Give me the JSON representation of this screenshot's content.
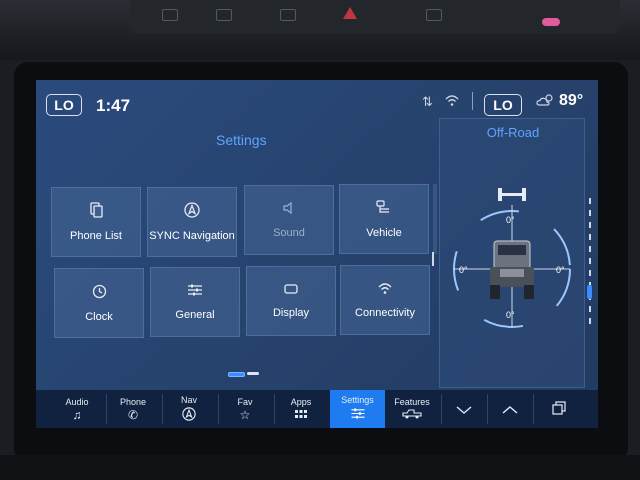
{
  "status_bar": {
    "left_temp": "LO",
    "time": "1:47",
    "right_temp": "LO",
    "outside_temp": "89°",
    "icons": [
      "data-arrows-icon",
      "wifi-icon",
      "weather-cloud-sun-icon"
    ]
  },
  "settings": {
    "title": "Settings",
    "tiles": [
      {
        "label": "Phone List",
        "icon": "phone-list-icon",
        "enabled": true
      },
      {
        "label": "SYNC Navigation",
        "icon": "navigation-icon",
        "enabled": true
      },
      {
        "label": "Sound",
        "icon": "speaker-icon",
        "enabled": false
      },
      {
        "label": "Vehicle",
        "icon": "vehicle-settings-icon",
        "enabled": true
      },
      {
        "label": "Clock",
        "icon": "clock-icon",
        "enabled": true
      },
      {
        "label": "General",
        "icon": "sliders-icon",
        "enabled": true
      },
      {
        "label": "Display",
        "icon": "display-icon",
        "enabled": true
      },
      {
        "label": "Connectivity",
        "icon": "wifi-icon",
        "enabled": true
      }
    ],
    "page_indicator": {
      "pages": 2,
      "current": 1
    }
  },
  "offroad": {
    "title": "Off-Road",
    "pitch_top": "0°",
    "pitch_bottom": "0°",
    "roll_left": "0°",
    "roll_right": "0°"
  },
  "nav": {
    "items": [
      {
        "label": "Audio",
        "icon": "music-note-icon"
      },
      {
        "label": "Phone",
        "icon": "phone-icon"
      },
      {
        "label": "Nav",
        "icon": "navigation-icon"
      },
      {
        "label": "Fav",
        "icon": "star-icon"
      },
      {
        "label": "Apps",
        "icon": "apps-grid-icon"
      },
      {
        "label": "Settings",
        "icon": "sliders-icon",
        "active": true
      },
      {
        "label": "Features",
        "icon": "truck-icon"
      }
    ]
  },
  "colors": {
    "accent": "#1f7cf0",
    "title_blue": "#5fa3ff",
    "screen_bg": "#27446f"
  }
}
